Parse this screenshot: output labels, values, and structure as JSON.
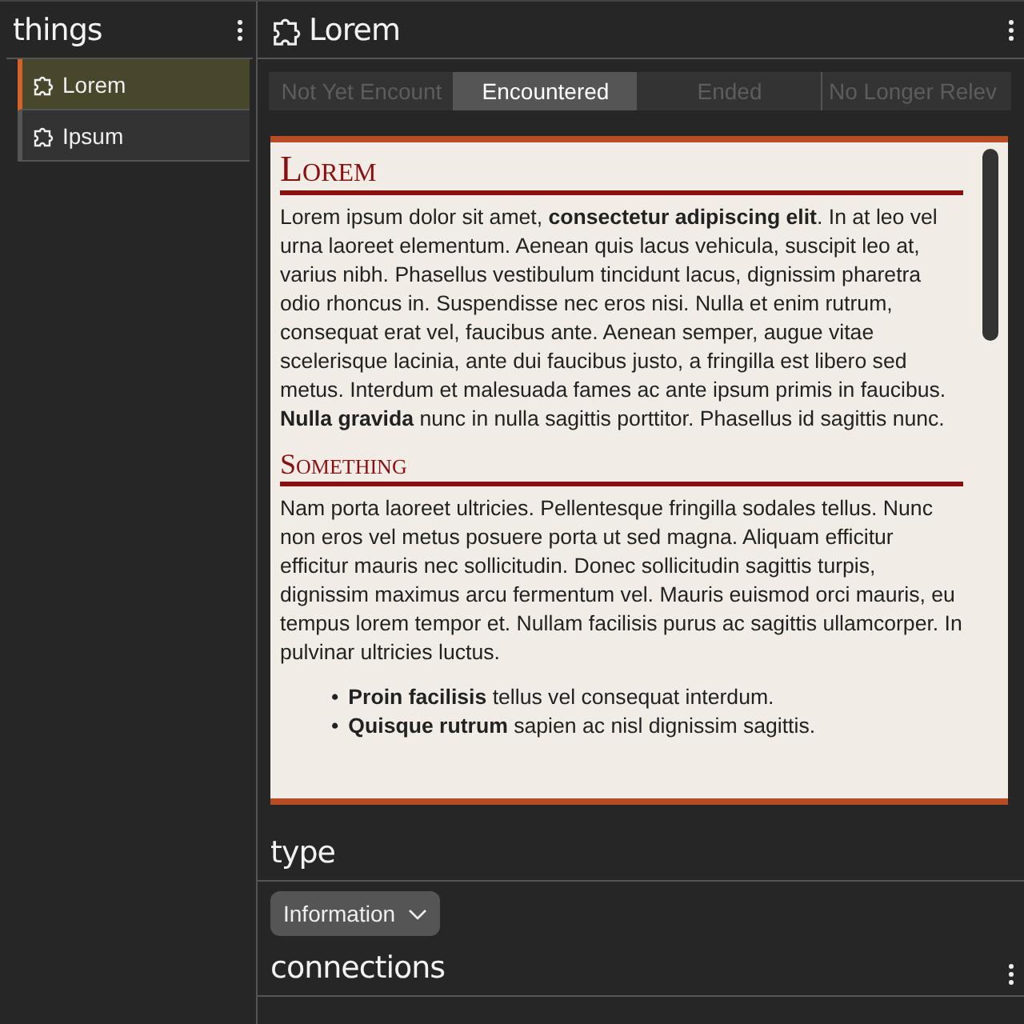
{
  "sidebar": {
    "title": "things",
    "items": [
      {
        "label": "Lorem",
        "selected": true
      },
      {
        "label": "Ipsum",
        "selected": false
      }
    ]
  },
  "main": {
    "title": "Lorem",
    "tabs": [
      {
        "label": "Not Yet Encount",
        "selected": false
      },
      {
        "label": "Encountered",
        "selected": true
      },
      {
        "label": "Ended",
        "selected": false
      },
      {
        "label": "No Longer Relev",
        "selected": false
      }
    ],
    "document": {
      "sections": [
        {
          "heading": "Lorem",
          "paragraphs": [
            "Lorem ipsum dolor sit amet, **consectetur adipiscing elit**. In at leo vel urna laoreet elementum. Aenean quis lacus vehicula, suscipit leo at, varius nibh. Phasellus vestibulum tincidunt lacus, dignissim pharetra odio rhoncus in. Suspendisse nec eros nisi. Nulla et enim rutrum, consequat erat vel, faucibus ante. Aenean semper, augue vitae scelerisque lacinia, ante dui faucibus justo, a fringilla est libero sed metus. Interdum et malesuada fames ac ante ipsum primis in faucibus. **Nulla gravida** nunc in nulla sagittis porttitor. Phasellus id sagittis nunc."
          ]
        },
        {
          "heading": "Something",
          "paragraphs": [
            "Nam porta laoreet ultricies. Pellentesque fringilla sodales tellus. Nunc non eros vel metus posuere porta ut sed magna. Aliquam efficitur efficitur mauris nec sollicitudin. Donec sollicitudin sagittis turpis, dignissim maximus arcu fermentum vel. Mauris euismod orci mauris, eu tempus lorem tempor et. Nullam facilisis purus ac sagittis ullamcorper. In pulvinar ultricies luctus."
          ],
          "bullets": [
            {
              "marker": "•",
              "text": "**Proin facilisis** tellus vel consequat interdum."
            },
            {
              "marker": "•",
              "text": "**Quisque rutrum** sapien ac nisl dignissim sagittis."
            }
          ]
        }
      ]
    },
    "type": {
      "heading": "type",
      "value": "Information"
    },
    "connections": {
      "heading": "connections"
    }
  }
}
